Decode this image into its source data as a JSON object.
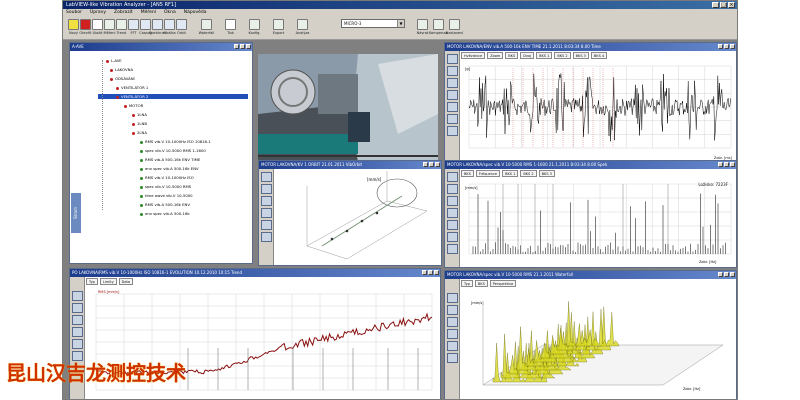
{
  "app": {
    "title": "LabVIEW-like Vibration Analyzer - [AN5 RF1]",
    "menu": [
      "Soubor",
      "Úpravy",
      "Zobrazit",
      "Měření",
      "Okna",
      "Nápověda"
    ],
    "toolbar_buttons": [
      "Nový",
      "Otevřít",
      "Uložit",
      "Měření",
      "Trend",
      "FFT",
      "Časový",
      "Spektrum",
      "Obálka",
      "Orbit",
      "Waterfall",
      "Tisk",
      "Konfig.",
      "Export",
      "Analýza",
      "Návrat",
      "Kompenzace",
      "Nastavení"
    ],
    "device_select": "MICRO-3"
  },
  "tree_window": {
    "title": "A-AVE",
    "side_tab": "Strom",
    "items": [
      {
        "label": "L-AVE",
        "indent": 0
      },
      {
        "label": "LAKOVNA",
        "indent": 1
      },
      {
        "label": "ODSÁVÁNÍ",
        "indent": 1
      },
      {
        "label": "VENTILÁTOR 1",
        "indent": 2
      },
      {
        "label": "VENTILÁTOR 2",
        "indent": 2,
        "selected": true
      },
      {
        "label": "MOTOR",
        "indent": 3
      },
      {
        "label": "1LNA",
        "indent": 4
      },
      {
        "label": "1LNB",
        "indent": 4
      },
      {
        "label": "2LNA",
        "indent": 4
      },
      {
        "label": "RMS vib.V 10-1000Hz ISO 10816-1",
        "indent": 5
      },
      {
        "label": "spec vib.V 10-5000 RMS 1-1600",
        "indent": 5
      },
      {
        "label": "RMS vib.A 500-16k ENV TIME",
        "indent": 5
      },
      {
        "label": "env spec vib.A 500-16k ENV",
        "indent": 5
      },
      {
        "label": "RMS vib.V 10-1000Hz ISO",
        "indent": 5
      },
      {
        "label": "spec vib.V 10-5000 RMS",
        "indent": 5
      },
      {
        "label": "time wave vib.V 10-5000",
        "indent": 5
      },
      {
        "label": "RMS vib.A 500-16k ENV",
        "indent": 5
      },
      {
        "label": "env spec vib.A 500-16k",
        "indent": 5
      }
    ]
  },
  "time_window": {
    "title": "MOTOR LAKOVNA/ENV vib.A 500-16k ENV TIME 21.1.2011 8:03:34 8.00 Time",
    "controls": [
      "Hvězdnice",
      "Zoom",
      "BKS",
      "Dvoj",
      "BKS 1",
      "BKS 2",
      "BKS 3",
      "BKS 4"
    ],
    "x_unit": "Zobr. [ms]",
    "y_unit": "[g]"
  },
  "orbit_window": {
    "title": "MOTOR LAKOVNA/KV 1 ORBIT 21.01.2011 VibOrbit",
    "y_unit": "[mm/s]"
  },
  "spectrum_window": {
    "title": "MOTOR LAKOVNA/spec vib.V 10-5000 RMS 1-1600 21.1.2011 8:03:34 8.00 Spek",
    "controls": [
      "BKS",
      "Fréquence",
      "BKS 1",
      "BKS 2",
      "BKS 3"
    ],
    "annotation": "Ložisko: 7223F",
    "x_unit": "Zobr. [Hz]",
    "y_unit": "[mm/s]"
  },
  "trend_window": {
    "title": "PO LAKOVNA/RMS vib.V 10-1000Hz ISO 10816-1 EVOLUTION 10.12.2010 10:15 Trend",
    "controls": [
      "Typ",
      "Limity",
      "Data"
    ],
    "legend_label": "RMS [mm/s]"
  },
  "waterfall_window": {
    "title": "MOTOR LAKOVNA/spec vib.V 10-5000 RMS 21.1.2011 Waterfall",
    "controls": [
      "Typ",
      "BKS",
      "Perspektiva"
    ],
    "y_unit": "[mm/s]",
    "x_unit": "Zobr. [Hz]"
  },
  "watermark": "昆山汉吉龙测控技术",
  "colors": {
    "caption": "#1c3c8c",
    "trace_time": "#000000",
    "trace_trend": "#8a1010",
    "trace_orbit": "#6a8a6a",
    "waterfall": "#d8d820",
    "watermark": "#d03000"
  }
}
